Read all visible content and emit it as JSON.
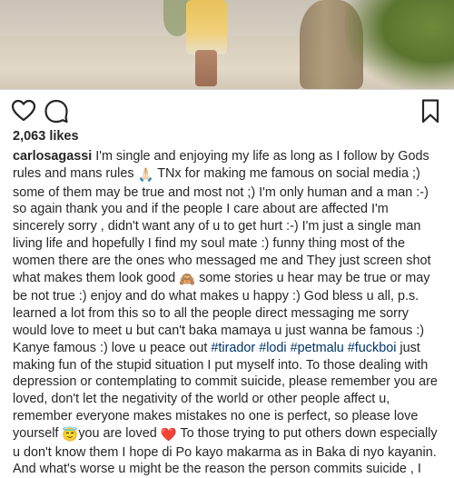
{
  "post": {
    "likes": "2,063 likes",
    "username": "carlosagassi",
    "emoji": {
      "pray": "🙏🏻",
      "see_no_evil": "🙈",
      "halo": "😇",
      "heart": "❤️"
    },
    "caption": {
      "l1": " I'm single and enjoying my life as long as I follow by Gods",
      "l2a": "rules and mans rules ",
      "l2b": " TNx for making me famous on social media ;)",
      "l3": "some of them may be true and most not ;) I'm only human and a man :-)",
      "l4": "so again thank you and if the people I care about are affected I'm",
      "l5": "sincerely sorry , didn't want any of u to get hurt :-) I'm just a single man",
      "l6": "living life and hopefully I find my soul mate :) funny thing most of the",
      "l7": "women there are the ones who messaged me and They just screen shot",
      "l8a": "what makes them look good ",
      "l8b": " some stories u hear may be true or may",
      "l9": "be not true :) enjoy and do what makes u happy :) God bless u all, p.s.",
      "l10": "learned a lot from this so to all the people direct messaging me sorry",
      "l11": "would love to meet u but can't baka mamaya u just wanna be famous :)",
      "l12a": "Kanye famous :) love u peace out ",
      "tag1": "#tirador",
      "tag2": "#lodi",
      "tag3": "#petmalu",
      "tag4": "#fuckboi",
      "l12b": " just",
      "l13": "making fun of the stupid situation I put myself into. To those dealing with",
      "l14": "depression or contemplating to commit suicide, please remember you are",
      "l15": "loved, don't let the negativity of the world or other people affect u,",
      "l16": "remember everyone makes mistakes no one is perfect, so please love",
      "l17a": "yourself ",
      "l17b": "you are loved ",
      "l17c": " To those trying to put others down especially",
      "l18": "u don't know them I hope di Po kayo makarma as in Baka di nyo kayanin.",
      "l19": "And what's worse u might be the reason the person commits suicide , I"
    }
  }
}
